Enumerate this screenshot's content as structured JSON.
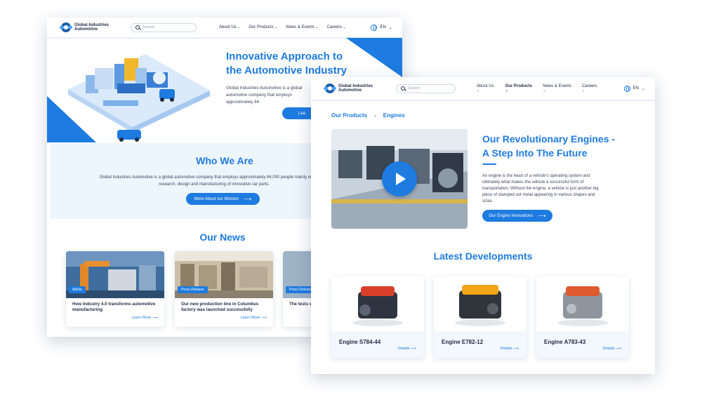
{
  "back_page": {
    "logo_text": "Global Industries Automotive",
    "search_placeholder": "Search",
    "menu": [
      "About Us",
      "Our Products",
      "News & Events",
      "Careers"
    ],
    "language": "EN",
    "hero": {
      "title_line1": "Innovative Approach to",
      "title_line2": "the Automotive Industry",
      "text": "Global Industries Automotive is a global automotive company that employs approximately 84",
      "button": "Lea"
    },
    "who": {
      "title": "Who We Are",
      "text": "Global Industries Automotive is a global automotive company that employs approximately 84,000 people mainly engaged in research, design and manufacturing of innovative car parts.",
      "button": "More About our Mission"
    },
    "news": {
      "title": "Our News",
      "cards": [
        {
          "tag": "Article",
          "headline": "How Industry 4.0 transforms automotive manufacturing",
          "link": "Learn More"
        },
        {
          "tag": "Press Release",
          "headline": "Our new production line in Columbus factory was launched successfully",
          "link": "Learn More"
        },
        {
          "tag": "Press Release",
          "headline": "The tests were succ",
          "link": ""
        }
      ]
    }
  },
  "front_page": {
    "logo_text": "Global Industries Automotive",
    "search_placeholder": "Search",
    "menu": [
      "About Us",
      "Our Products",
      "News & Events",
      "Careers"
    ],
    "active_menu": "Our Products",
    "language": "EN",
    "breadcrumb": [
      "Our Products",
      "Engines"
    ],
    "breadcrumb_separator": "›",
    "headline_line1": "Our Revolutionary Engines -",
    "headline_line2": "A Step Into The Future",
    "body": "An engine is the heart of a vehicle's operating system and ultimately what makes the vehicle a successful form of transportation.  Without the engine, a vehicle is just another big piece of stamped out metal appearing in various shapes and sizes.",
    "button": "Our Engine Innovations",
    "latest_title": "Latest Developments",
    "products": [
      {
        "name": "Engine S784-44",
        "link": "Details",
        "accent": "#d8402c"
      },
      {
        "name": "Engine E782-12",
        "link": "Details",
        "accent": "#f2a516"
      },
      {
        "name": "Engine A783-43",
        "link": "Details",
        "accent": "#e05a30"
      }
    ]
  },
  "colors": {
    "primary": "#1e7be0",
    "heading": "#1f2a44",
    "light_band": "#edf5fd"
  },
  "icons": [
    "logo-icon",
    "search-icon",
    "globe-icon",
    "chevron-down-icon",
    "arrow-right-icon",
    "play-icon"
  ]
}
